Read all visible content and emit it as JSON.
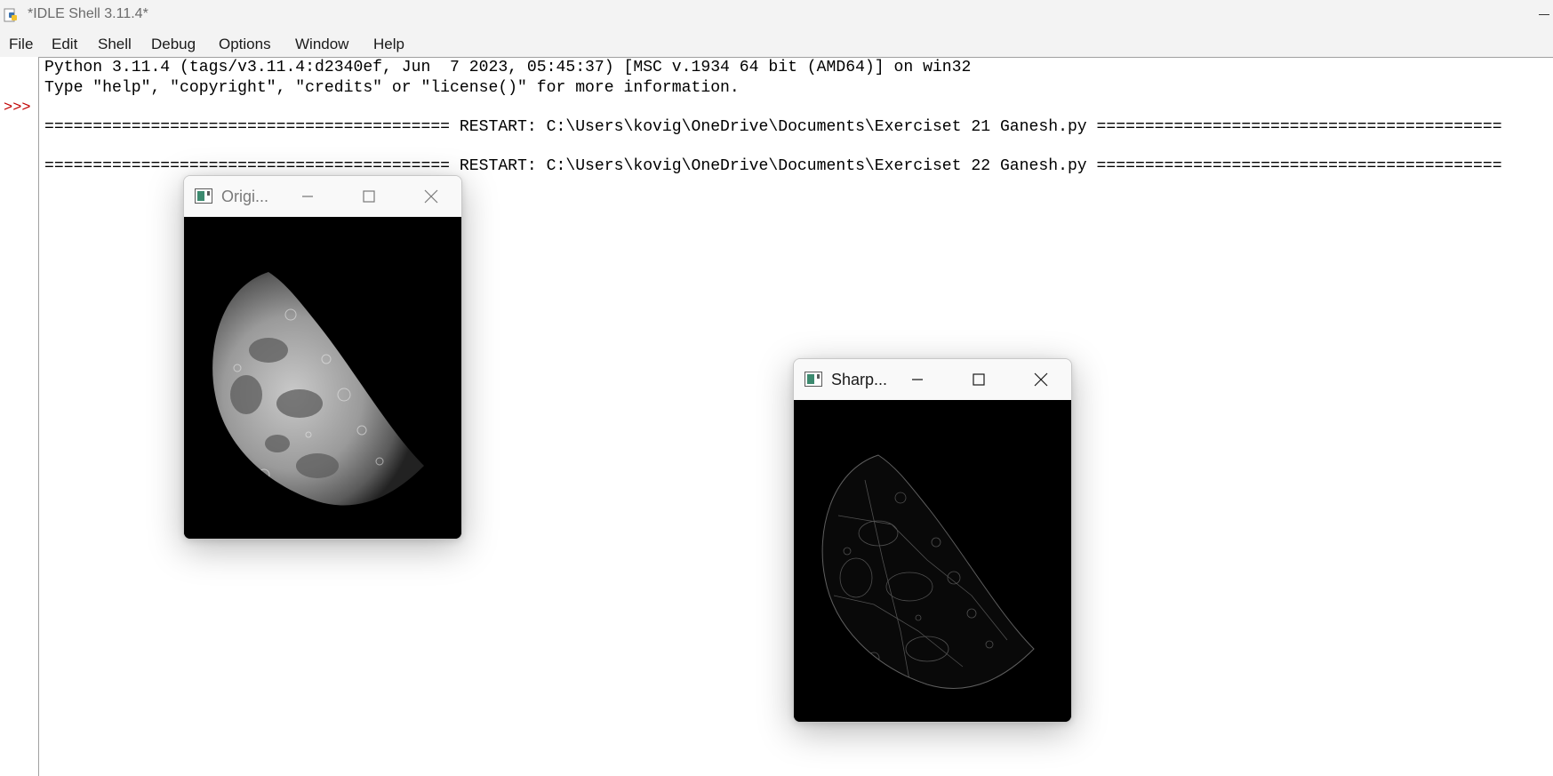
{
  "window": {
    "title": "*IDLE Shell 3.11.4*"
  },
  "menu": [
    "File",
    "Edit",
    "Shell",
    "Debug",
    "Options",
    "Window",
    "Help"
  ],
  "shell": {
    "prompt": ">>>",
    "lines": [
      "Python 3.11.4 (tags/v3.11.4:d2340ef, Jun  7 2023, 05:45:37) [MSC v.1934 64 bit (AMD64)] on win32",
      "Type \"help\", \"copyright\", \"credits\" or \"license()\" for more information.",
      "========================================== RESTART: C:\\Users\\kovig\\OneDrive\\Documents\\Exerciset 21 Ganesh.py ==========================================",
      "========================================== RESTART: C:\\Users\\kovig\\OneDrive\\Documents\\Exerciset 22 Ganesh.py =========================================="
    ]
  },
  "windows": {
    "original": {
      "title": "Origi...",
      "image": "moon-original-image"
    },
    "sharpened": {
      "title": "Sharp...",
      "image": "moon-sharpened-image"
    }
  },
  "colors": {
    "titlebar_bg": "#f3f3f3",
    "prompt": "#c00000",
    "image_bg": "#000000"
  }
}
